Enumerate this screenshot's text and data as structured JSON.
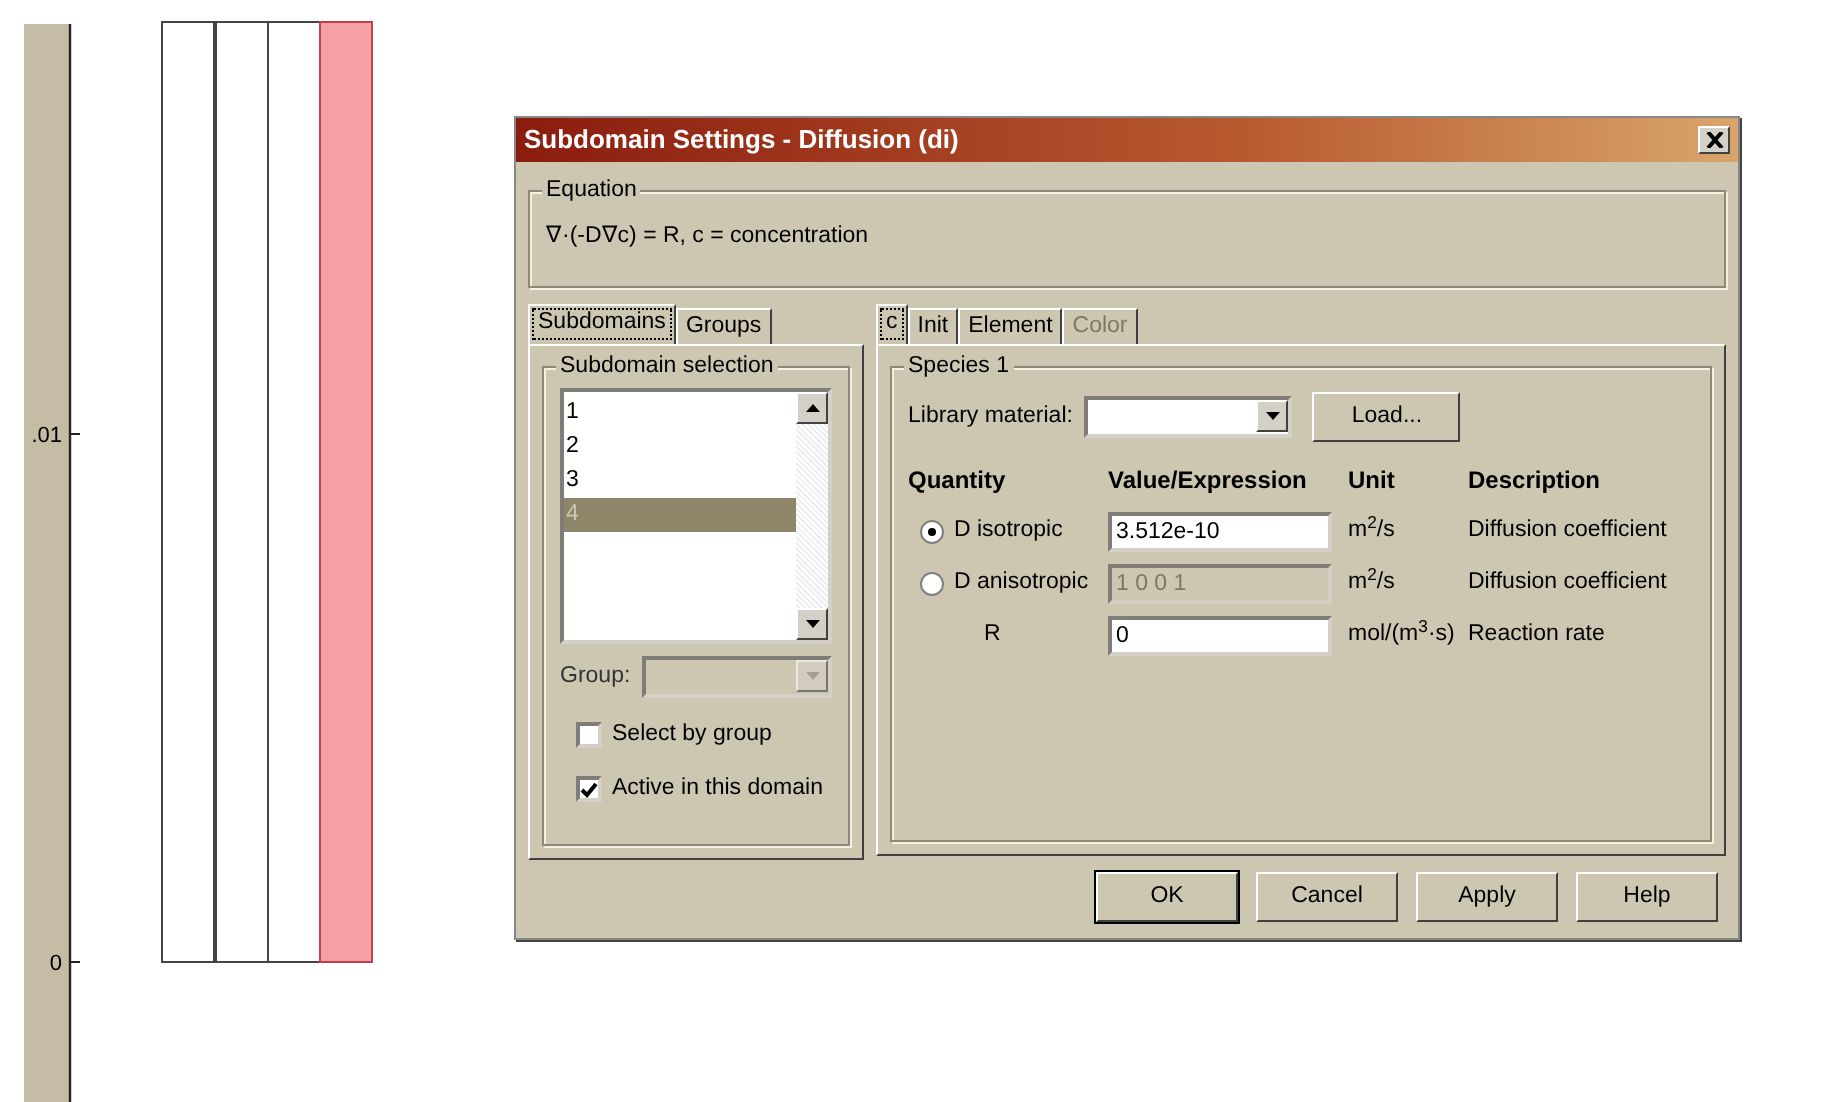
{
  "plot": {
    "y_ticks": [
      ".01",
      "0"
    ],
    "subdomains": [
      {
        "selected": false
      },
      {
        "selected": false
      },
      {
        "selected": false
      },
      {
        "selected": true
      }
    ]
  },
  "window": {
    "title": "Subdomain Settings - Diffusion (di)"
  },
  "equation": {
    "legend": "Equation",
    "text": "∇·(-D∇c) = R, c = concentration"
  },
  "left_tabs": [
    {
      "label": "Subdomains",
      "selected": true
    },
    {
      "label": "Groups",
      "selected": false
    }
  ],
  "subdomain_selection": {
    "legend": "Subdomain selection",
    "items": [
      {
        "label": "1",
        "selected": false
      },
      {
        "label": "2",
        "selected": false
      },
      {
        "label": "3",
        "selected": false
      },
      {
        "label": "4",
        "selected": true
      }
    ],
    "group_label": "Group:",
    "checkboxes": [
      {
        "label": "Select by group",
        "checked": false
      },
      {
        "label": "Active in this domain",
        "checked": true
      }
    ]
  },
  "right_tabs": [
    {
      "label": "c",
      "selected": true,
      "disabled": false
    },
    {
      "label": "Init",
      "selected": false,
      "disabled": false
    },
    {
      "label": "Element",
      "selected": false,
      "disabled": false
    },
    {
      "label": "Color",
      "selected": false,
      "disabled": true
    }
  ],
  "species": {
    "legend": "Species 1",
    "library_label": "Library material:",
    "load_button": "Load...",
    "columns": [
      "Quantity",
      "Value/Expression",
      "Unit",
      "Description"
    ],
    "rows": [
      {
        "kind": "radio",
        "label": "D isotropic",
        "checked": true,
        "value": "3.512e-10",
        "disabled": false,
        "unit": "m$^{2}$/s",
        "description": "Diffusion coefficient"
      },
      {
        "kind": "radio",
        "label": "D anisotropic",
        "checked": false,
        "value": "1 0 0 1",
        "disabled": true,
        "unit": "m$^{2}$/s",
        "description": "Diffusion coefficient"
      },
      {
        "kind": "plain",
        "label": "R",
        "value": "0",
        "disabled": false,
        "unit": "mol/(m$^{3}$·s)",
        "description": "Reaction rate"
      }
    ]
  },
  "buttons": [
    {
      "label": "OK",
      "default": true
    },
    {
      "label": "Cancel",
      "default": false
    },
    {
      "label": "Apply",
      "default": false
    },
    {
      "label": "Help",
      "default": false
    }
  ]
}
